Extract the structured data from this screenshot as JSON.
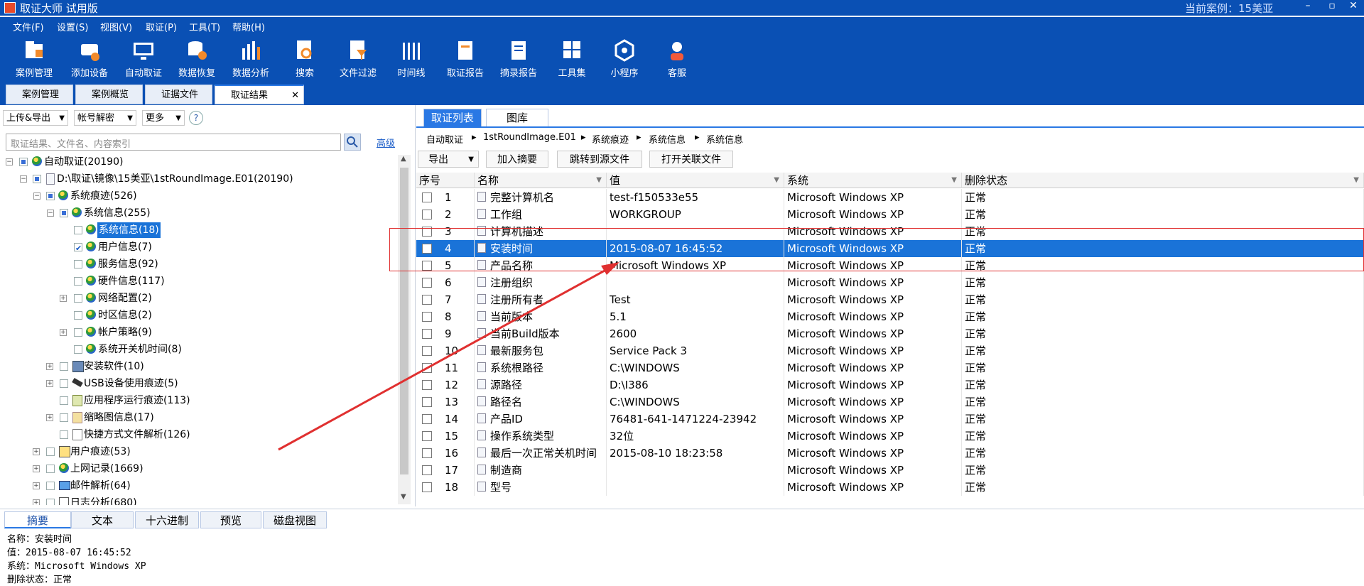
{
  "app": {
    "title": "取证大师 试用版",
    "current_case": "当前案例：15美亚",
    "win_min": "–",
    "win_max": "▫",
    "win_close": "✕"
  },
  "menu": [
    "文件(F)",
    "设置(S)",
    "视图(V)",
    "取证(P)",
    "工具(T)",
    "帮助(H)"
  ],
  "toolbar": [
    {
      "label": "案例管理",
      "icon": "case-manage-icon"
    },
    {
      "label": "添加设备",
      "icon": "add-device-icon"
    },
    {
      "label": "自动取证",
      "icon": "auto-forensics-icon"
    },
    {
      "label": "数据恢复",
      "icon": "data-recovery-icon"
    },
    {
      "label": "数据分析",
      "icon": "data-analysis-icon"
    },
    {
      "label": "搜索",
      "icon": "search-icon"
    },
    {
      "label": "文件过滤",
      "icon": "file-filter-icon"
    },
    {
      "label": "时间线",
      "icon": "timeline-icon"
    },
    {
      "label": "取证报告",
      "icon": "forensic-report-icon"
    },
    {
      "label": "摘录报告",
      "icon": "excerpt-report-icon"
    },
    {
      "label": "工具集",
      "icon": "toolset-icon"
    },
    {
      "label": "小程序",
      "icon": "mini-program-icon"
    },
    {
      "label": "客服",
      "icon": "customer-service-icon"
    }
  ],
  "doc_tabs": [
    "案例管理",
    "案例概览",
    "证据文件",
    "取证结果"
  ],
  "doc_tab_close": "✕",
  "left": {
    "dropdowns": [
      "上传&导出",
      "帐号解密",
      "更多"
    ],
    "help": "?",
    "search_placeholder": "取证结果、文件名、内容索引",
    "advanced": "高级",
    "tree": [
      "自动取证(20190)",
      "D:\\取证\\镜像\\15美亚\\1stRoundImage.E01(20190)",
      "系统痕迹(526)",
      "系统信息(255)",
      "系统信息(18)",
      "用户信息(7)",
      "服务信息(92)",
      "硬件信息(117)",
      "网络配置(2)",
      "时区信息(2)",
      "帐户策略(9)",
      "系统开关机时间(8)",
      "安装软件(10)",
      "USB设备使用痕迹(5)",
      "应用程序运行痕迹(113)",
      "缩略图信息(17)",
      "快捷方式文件解析(126)",
      "用户痕迹(53)",
      "上网记录(1669)",
      "邮件解析(64)",
      "日志分析(680)"
    ]
  },
  "right": {
    "tabs": [
      "取证列表",
      "图库"
    ],
    "breadcrumb": [
      "自动取证",
      "1stRoundImage.E01",
      "系统痕迹",
      "系统信息",
      "系统信息"
    ],
    "breadcrumb_sep": "▸",
    "buttons": [
      "导出",
      "加入摘要",
      "跳转到源文件",
      "打开关联文件"
    ],
    "columns": [
      "序号",
      "名称",
      "值",
      "系统",
      "删除状态"
    ],
    "rows": [
      {
        "n": "1",
        "name": "完整计算机名",
        "value": "test-f150533e55",
        "sys": "Microsoft Windows XP",
        "del": "正常"
      },
      {
        "n": "2",
        "name": "工作组",
        "value": "WORKGROUP",
        "sys": "Microsoft Windows XP",
        "del": "正常"
      },
      {
        "n": "3",
        "name": "计算机描述",
        "value": "",
        "sys": "Microsoft Windows XP",
        "del": "正常"
      },
      {
        "n": "4",
        "name": "安装时间",
        "value": "2015-08-07 16:45:52",
        "sys": "Microsoft Windows XP",
        "del": "正常"
      },
      {
        "n": "5",
        "name": "产品名称",
        "value": "Microsoft Windows XP",
        "sys": "Microsoft Windows XP",
        "del": "正常"
      },
      {
        "n": "6",
        "name": "注册组织",
        "value": "",
        "sys": "Microsoft Windows XP",
        "del": "正常"
      },
      {
        "n": "7",
        "name": "注册所有者",
        "value": "Test",
        "sys": "Microsoft Windows XP",
        "del": "正常"
      },
      {
        "n": "8",
        "name": "当前版本",
        "value": "5.1",
        "sys": "Microsoft Windows XP",
        "del": "正常"
      },
      {
        "n": "9",
        "name": "当前Build版本",
        "value": "2600",
        "sys": "Microsoft Windows XP",
        "del": "正常"
      },
      {
        "n": "10",
        "name": "最新服务包",
        "value": "Service Pack 3",
        "sys": "Microsoft Windows XP",
        "del": "正常"
      },
      {
        "n": "11",
        "name": "系统根路径",
        "value": "C:\\WINDOWS",
        "sys": "Microsoft Windows XP",
        "del": "正常"
      },
      {
        "n": "12",
        "name": "源路径",
        "value": "D:\\I386",
        "sys": "Microsoft Windows XP",
        "del": "正常"
      },
      {
        "n": "13",
        "name": "路径名",
        "value": "C:\\WINDOWS",
        "sys": "Microsoft Windows XP",
        "del": "正常"
      },
      {
        "n": "14",
        "name": "产品ID",
        "value": "76481-641-1471224-23942",
        "sys": "Microsoft Windows XP",
        "del": "正常"
      },
      {
        "n": "15",
        "name": "操作系统类型",
        "value": "32位",
        "sys": "Microsoft Windows XP",
        "del": "正常"
      },
      {
        "n": "16",
        "name": "最后一次正常关机时间",
        "value": "2015-08-10 18:23:58",
        "sys": "Microsoft Windows XP",
        "del": "正常"
      },
      {
        "n": "17",
        "name": "制造商",
        "value": "",
        "sys": "Microsoft Windows XP",
        "del": "正常"
      },
      {
        "n": "18",
        "name": "型号",
        "value": "",
        "sys": "Microsoft Windows XP",
        "del": "正常"
      }
    ]
  },
  "bottom": {
    "tabs": [
      "摘要",
      "文本",
      "十六进制",
      "预览",
      "磁盘视图"
    ],
    "summary": [
      "名称：安装时间",
      "值：2015-08-07 16:45:52",
      "系统：Microsoft Windows XP",
      "删除状态：正常"
    ]
  },
  "colors": {
    "brand": "#0a50b4",
    "accent": "#2a78e4",
    "selection": "#1a73d8",
    "annotation": "#e03030"
  }
}
